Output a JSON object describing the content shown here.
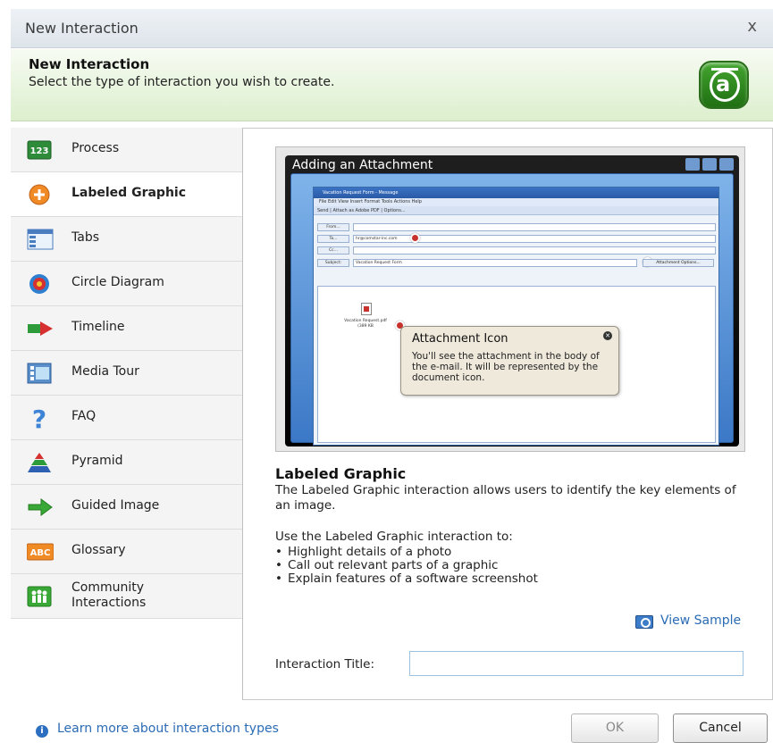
{
  "window": {
    "title": "New Interaction",
    "close_glyph": "x"
  },
  "header": {
    "title": "New Interaction",
    "subtitle": "Select the type of interaction you wish to create.",
    "logo_letter": "a"
  },
  "sidebar": {
    "items": [
      {
        "label": "Process",
        "icon": "process-123-icon",
        "selected": false
      },
      {
        "label": "Labeled Graphic",
        "icon": "labeled-graphic-icon",
        "selected": true
      },
      {
        "label": "Tabs",
        "icon": "tabs-icon",
        "selected": false
      },
      {
        "label": "Circle Diagram",
        "icon": "circle-diagram-icon",
        "selected": false
      },
      {
        "label": "Timeline",
        "icon": "timeline-icon",
        "selected": false
      },
      {
        "label": "Media Tour",
        "icon": "media-tour-icon",
        "selected": false
      },
      {
        "label": "FAQ",
        "icon": "faq-question-icon",
        "selected": false
      },
      {
        "label": "Pyramid",
        "icon": "pyramid-icon",
        "selected": false
      },
      {
        "label": "Guided Image",
        "icon": "guided-image-arrow-icon",
        "selected": false
      },
      {
        "label": "Glossary",
        "icon": "glossary-abc-icon",
        "selected": false
      },
      {
        "label": "Community\nInteractions",
        "icon": "community-people-icon",
        "selected": false
      }
    ]
  },
  "preview": {
    "bar_title": "Adding an Attachment",
    "mail": {
      "window_title": "Vacation Request Form - Message",
      "menu": "File  Edit  View  Insert  Format  Tools  Actions  Help",
      "toolbar": "Send  |  Attach as Adobe PDF  |  Options...",
      "from_label": "From...",
      "to_label": "To...",
      "to_value": "hr@comstar-inc.com",
      "cc_label": "Cc...",
      "subject_label": "Subject:",
      "subject_value": "Vacation Request Form",
      "attachment_options": "Attachment Options...",
      "doc_caption": "Vacation Request.pdf (389 KB"
    },
    "callout": {
      "title": "Attachment Icon",
      "text": "You'll see the attachment in the body of the e-mail.  It will be represented by the document icon."
    }
  },
  "description": {
    "title": "Labeled Graphic",
    "text": "The Labeled Graphic interaction allows users to identify the key elements of an image.",
    "use_intro": "Use the Labeled Graphic interaction to:",
    "uses": [
      "Highlight details of a photo",
      "Call out relevant parts of a graphic",
      "Explain features of a software screenshot"
    ]
  },
  "view_sample_label": "View Sample",
  "form": {
    "title_label": "Interaction Title:",
    "title_value": "",
    "title_placeholder": ""
  },
  "footer": {
    "learn_more": "Learn more about interaction types",
    "ok_label": "OK",
    "cancel_label": "Cancel",
    "ok_enabled": false
  },
  "colors": {
    "link": "#2a6bb5",
    "header_green": "#dcefcd",
    "logo_green": "#2f8a1f"
  }
}
